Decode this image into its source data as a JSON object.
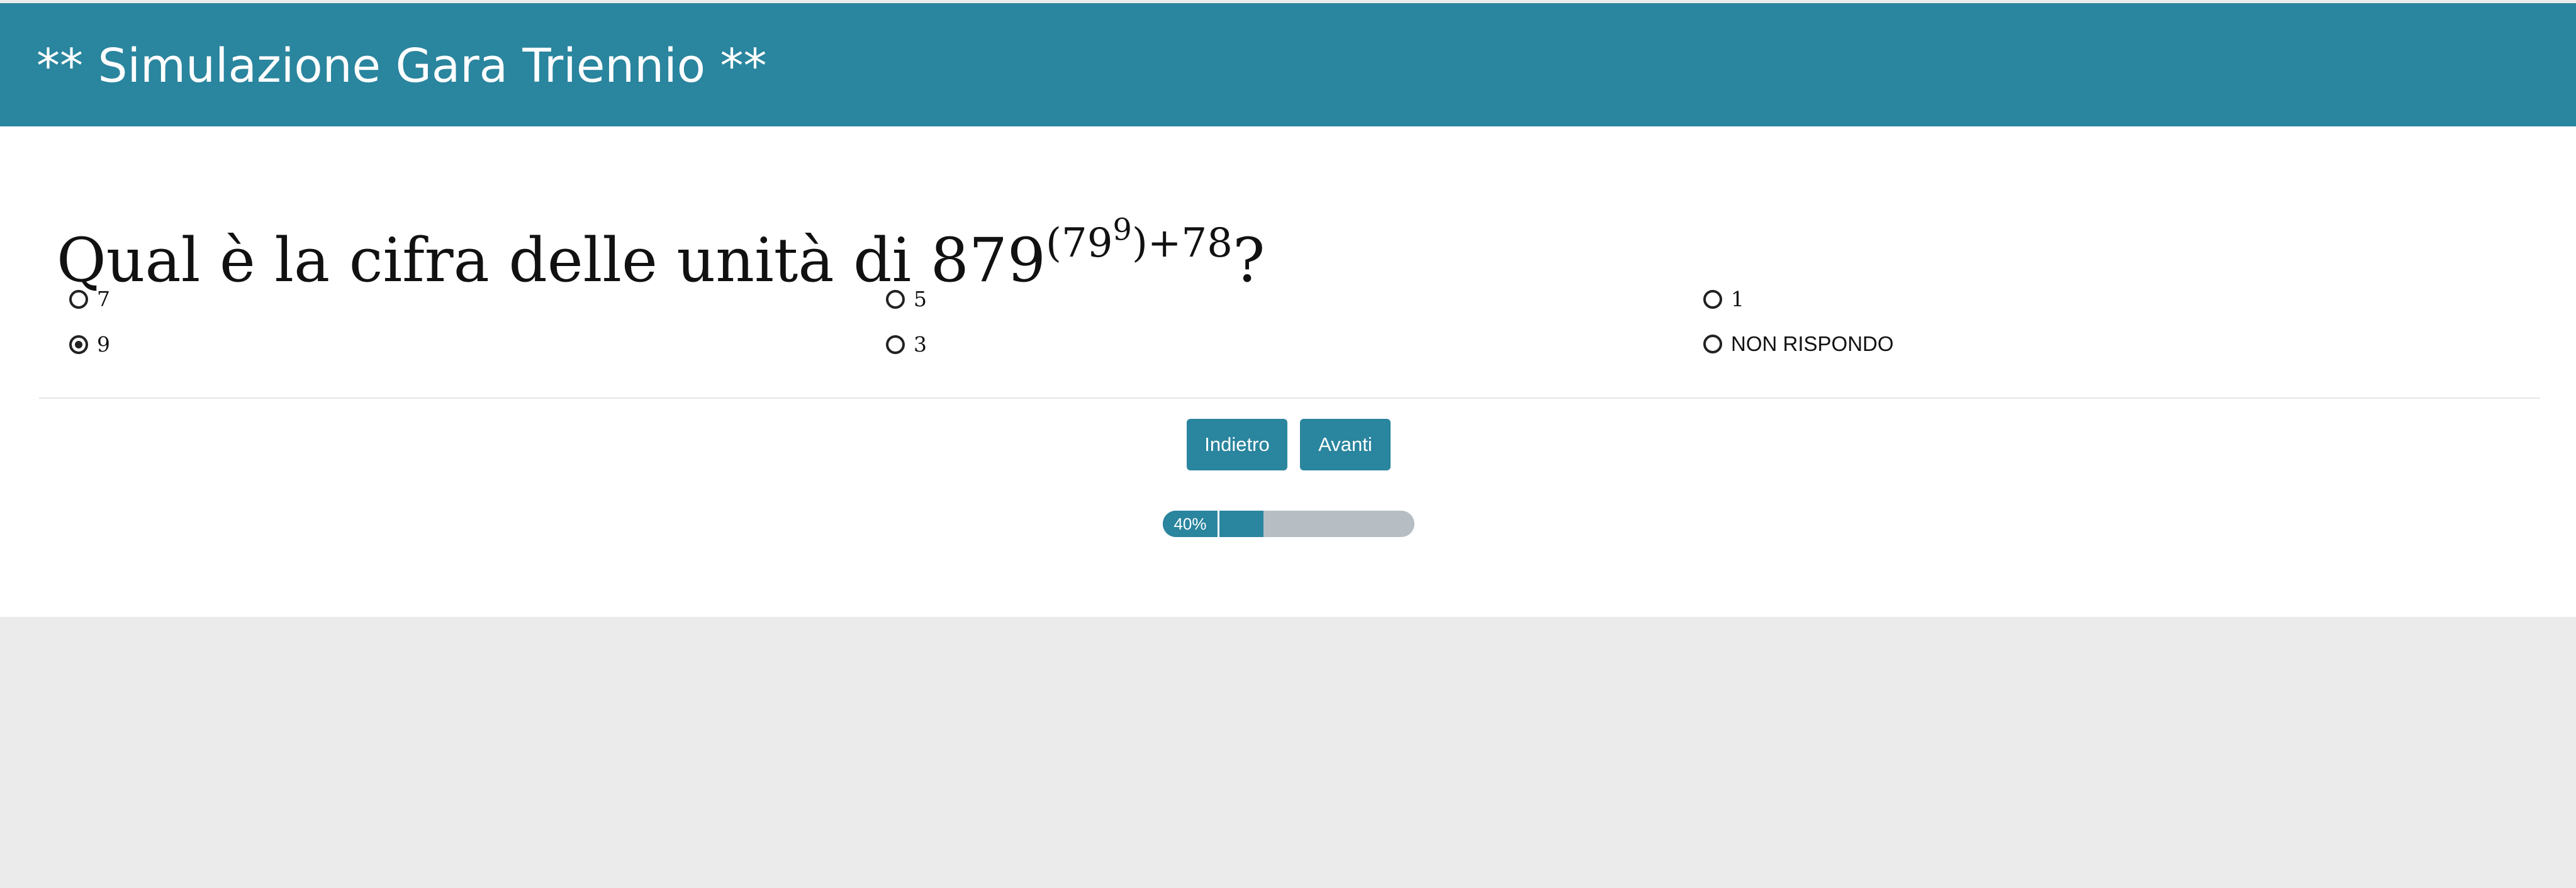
{
  "header": {
    "title": "** Simulazione Gara Triennio **"
  },
  "question": {
    "prefix": "Qual è la cifra delle unità di 879",
    "exp_base": "(79",
    "exp_inner": "9",
    "exp_close": ")+78",
    "suffix": "?"
  },
  "options": [
    {
      "label": "7",
      "selected": false
    },
    {
      "label": "5",
      "selected": false
    },
    {
      "label": "1",
      "selected": false
    },
    {
      "label": "9",
      "selected": true
    },
    {
      "label": "3",
      "selected": false
    },
    {
      "label": "NON RISPONDO",
      "selected": false
    }
  ],
  "buttons": {
    "back_label": "Indietro",
    "next_label": "Avanti"
  },
  "progress": {
    "label": "40%",
    "value": 0.4
  },
  "colors": {
    "accent": "#2a859e",
    "progress_track": "#b6bec3",
    "page_background": "#ebebeb"
  }
}
